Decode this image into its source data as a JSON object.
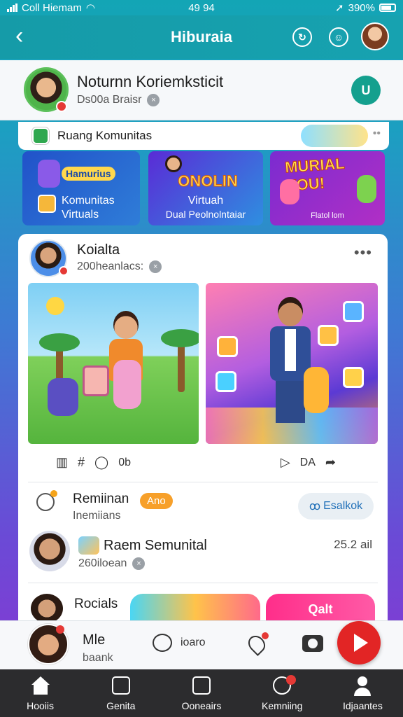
{
  "status_bar": {
    "carrier": "Coll Hiemam",
    "time": "49 94",
    "battery": "390%"
  },
  "header": {
    "title": "Hiburaia"
  },
  "profile": {
    "name": "Noturnn Koriemksticit",
    "subtitle": "Ds00a Braisr"
  },
  "community": {
    "label": "Ruang Komunitas"
  },
  "banners": [
    {
      "tag": "Hamurius",
      "line1": "Komunitas",
      "line2": "Virtuals"
    },
    {
      "headline": "ONOLIN",
      "line1": "Virtuah",
      "line2": "Dual Peolnolntaiar"
    },
    {
      "headline": "MURIAL YOU!",
      "line1": "Flatol lom"
    }
  ],
  "post": {
    "author": "Koialta",
    "subtitle": "200heanlacs:"
  },
  "actions": {
    "left_hash": "#",
    "left_count": "0b",
    "right_label": "DA"
  },
  "reminder": {
    "title": "Remiinan",
    "badge": "Ano",
    "subtitle": "Inemiians",
    "feedback_label": "Esalkok"
  },
  "person": {
    "title": "Raem Semunital",
    "subtitle": "260iloean",
    "time": "25.2 ail"
  },
  "reels": {
    "title": "Rocials",
    "card_text": "Qalt"
  },
  "now_playing": {
    "title": "Mle",
    "subtitle": "baank",
    "chat_label": "ioaro"
  },
  "bottom_nav": [
    {
      "label": "Hooiis",
      "icon": "home-icon"
    },
    {
      "label": "Genita",
      "icon": "search-doc-icon"
    },
    {
      "label": "Ooneairs",
      "icon": "clipboard-icon"
    },
    {
      "label": "Kemniing",
      "icon": "music-icon"
    },
    {
      "label": "Idjaantes",
      "icon": "profile-icon"
    }
  ],
  "colors": {
    "header": "#159ba8",
    "accent_red": "#e22525",
    "badge_orange": "#f7a02a",
    "mic_green": "#14a08e"
  }
}
